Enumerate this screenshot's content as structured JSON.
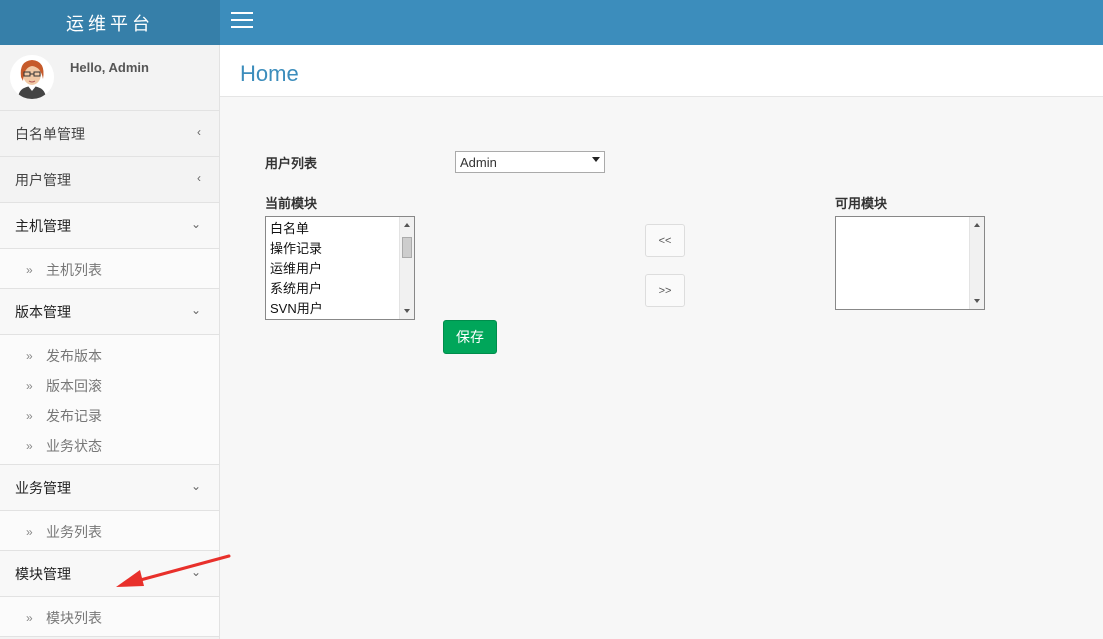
{
  "app": {
    "title": "运维平台",
    "greeting": "Hello, Admin"
  },
  "page": {
    "title": "Home"
  },
  "sidebar": {
    "sections": [
      {
        "label": "白名单管理",
        "state": "collapsed",
        "items": []
      },
      {
        "label": "用户管理",
        "state": "collapsed",
        "items": []
      },
      {
        "label": "主机管理",
        "state": "open",
        "items": [
          "主机列表"
        ]
      },
      {
        "label": "版本管理",
        "state": "open",
        "items": [
          "发布版本",
          "版本回滚",
          "发布记录",
          "业务状态"
        ]
      },
      {
        "label": "业务管理",
        "state": "open",
        "items": [
          "业务列表"
        ]
      },
      {
        "label": "模块管理",
        "state": "open",
        "items": [
          "模块列表"
        ]
      }
    ]
  },
  "form": {
    "user_list_label": "用户列表",
    "user_select_value": "Admin",
    "current_modules_label": "当前模块",
    "current_modules": [
      "白名单",
      "操作记录",
      "运维用户",
      "系统用户",
      "SVN用户"
    ],
    "available_modules_label": "可用模块",
    "available_modules": [],
    "move_left_label": "<<",
    "move_right_label": ">>",
    "save_label": "保存"
  },
  "colors": {
    "topbar": "#3c8dbc",
    "logo_bg": "#367fa9",
    "save": "#00a65a",
    "annotation": "#e8302b"
  },
  "icons": {
    "menu": "hamburger-icon",
    "collapsed": "chevron-left-icon",
    "open": "chevron-down-icon",
    "subitem": "double-chevron-right-icon"
  }
}
